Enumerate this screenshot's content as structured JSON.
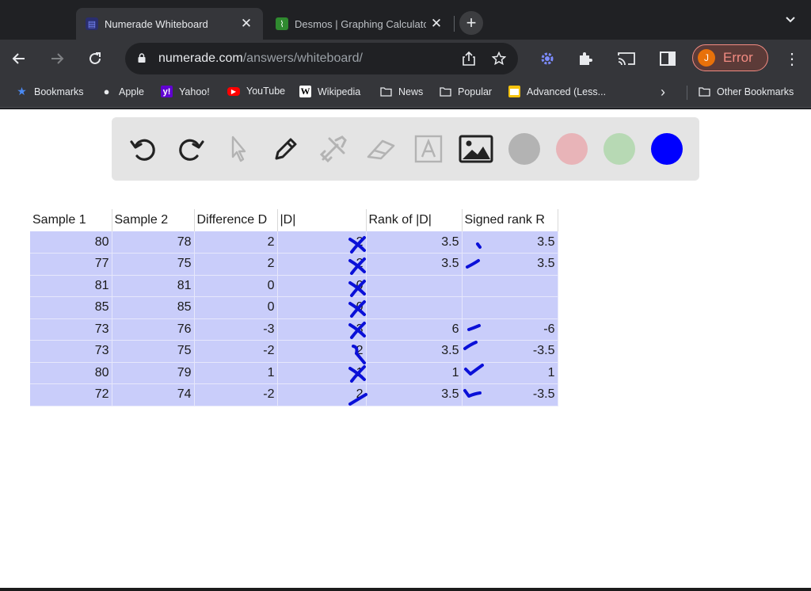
{
  "browser": {
    "tabs": [
      {
        "title": "Numerade Whiteboard",
        "active": true
      },
      {
        "title": "Desmos | Graphing Calculato",
        "active": false
      }
    ],
    "new_tab": "+",
    "url_host": "numerade.com",
    "url_path": "/answers/whiteboard/",
    "profile_initial": "J",
    "profile_status": "Error",
    "bookmarks": [
      "Bookmarks",
      "Apple",
      "Yahoo!",
      "YouTube",
      "Wikipedia",
      "News",
      "Popular",
      "Advanced (Less..."
    ],
    "other_bookmarks": "Other Bookmarks",
    "colors": {
      "frame": "#202124",
      "toolbar": "#35363a",
      "error": "#f28b82"
    }
  },
  "whiteboard": {
    "tools": [
      "undo-icon",
      "redo-icon",
      "pointer-icon",
      "pen-icon",
      "tools-icon",
      "eraser-icon",
      "text-icon",
      "image-icon"
    ],
    "swatches": [
      "#b3b3b3",
      "#e8b4b8",
      "#b7d9b4",
      "#0000ff"
    ],
    "ink_color": "#0a10d8"
  },
  "table": {
    "headers": [
      "Sample 1",
      "Sample 2",
      "Difference D",
      "|D|",
      "Rank of |D|",
      "Signed rank R"
    ],
    "rows": [
      [
        "80",
        "78",
        "2",
        "2",
        "3.5",
        "3.5"
      ],
      [
        "77",
        "75",
        "2",
        "2",
        "3.5",
        "3.5"
      ],
      [
        "81",
        "81",
        "0",
        "0",
        "",
        ""
      ],
      [
        "85",
        "85",
        "0",
        "0",
        "",
        ""
      ],
      [
        "73",
        "76",
        "-3",
        "3",
        "6",
        "-6"
      ],
      [
        "73",
        "75",
        "-2",
        "2",
        "3.5",
        "-3.5"
      ],
      [
        "80",
        "79",
        "1",
        "1",
        "1",
        "1"
      ],
      [
        "72",
        "74",
        "-2",
        "2",
        "3.5",
        "-3.5"
      ]
    ],
    "highlight_color": "#c9cdfa"
  }
}
